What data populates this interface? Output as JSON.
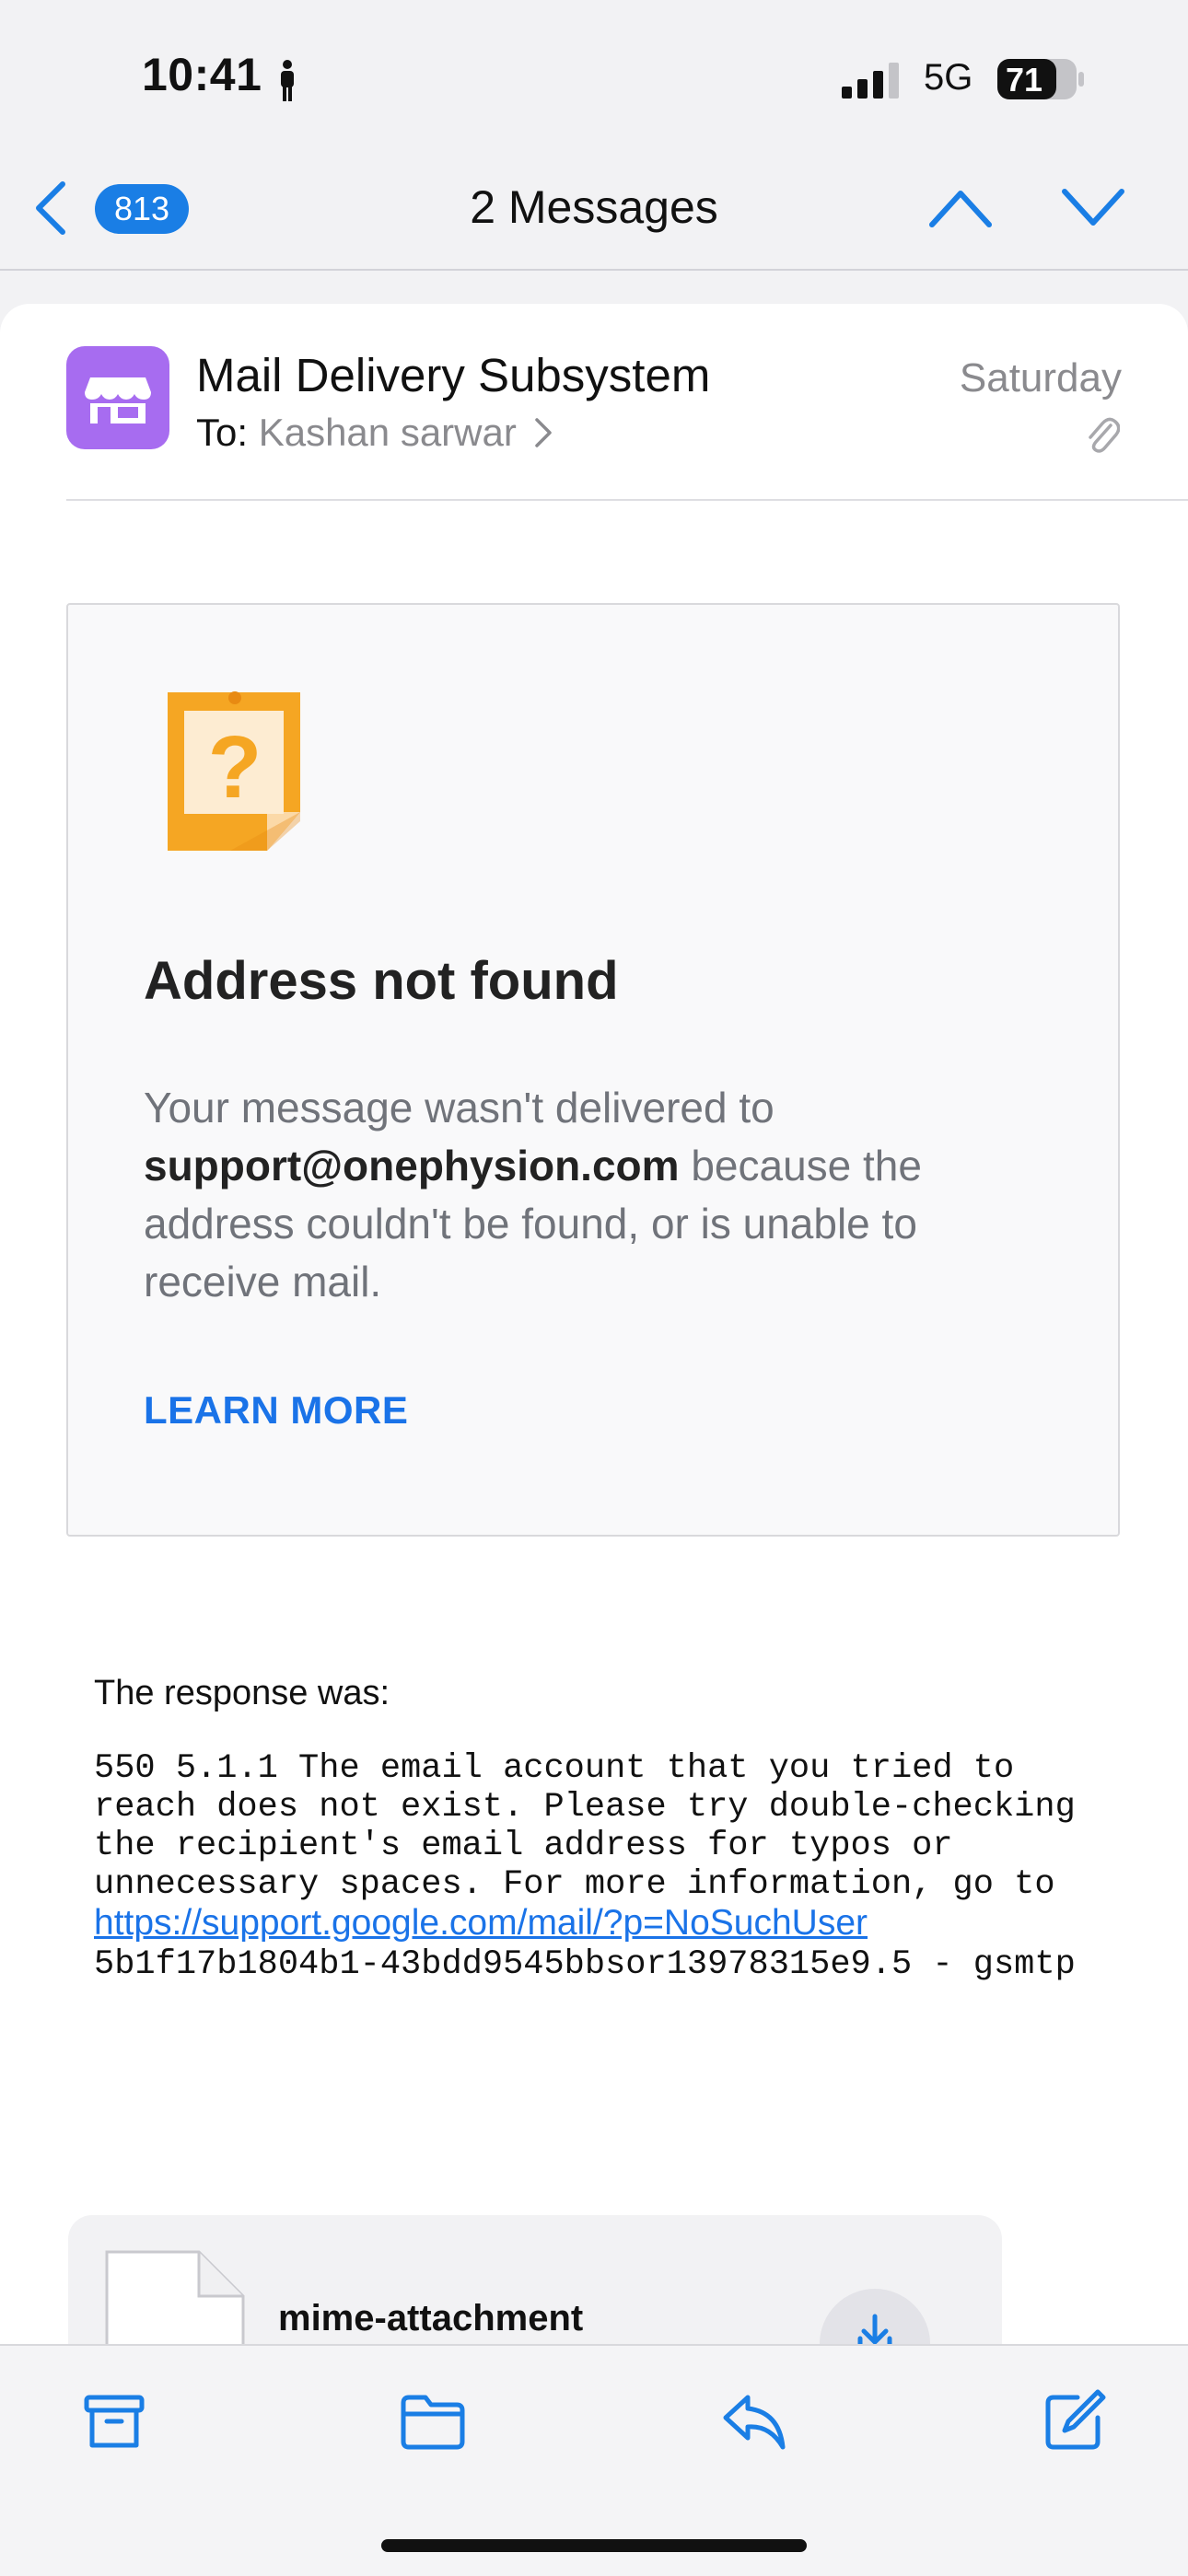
{
  "status_bar": {
    "time": "10:41",
    "network": "5G",
    "battery": "71"
  },
  "nav": {
    "unread_count": "813",
    "title": "2 Messages"
  },
  "message": {
    "sender": "Mail Delivery Subsystem",
    "to_label": "To:",
    "recipient": "Kashan sarwar",
    "date": "Saturday"
  },
  "bounce": {
    "title": "Address not found",
    "text_before": "Your message wasn't delivered to ",
    "email": "support@onephysion.com",
    "text_after": " because the address couldn't be found, or is unable to receive mail.",
    "learn_more": "LEARN MORE"
  },
  "response": {
    "label": "The response was:",
    "body_part1": "550 5.1.1 The email account that you tried to reach does not exist. Please try double-checking the recipient's email address for typos or unnecessary spaces. For more information, go to ",
    "link": "https://support.google.com/mail/?p=NoSuchUser",
    "body_part2": "\n5b1f17b1804b1-43bdd9545bbsor13978315e9.5 - gsmtp"
  },
  "attachment": {
    "name": "mime-attachment"
  },
  "toolbar": {
    "icons": [
      "archive-icon",
      "folder-icon",
      "reply-icon",
      "compose-icon"
    ]
  },
  "colors": {
    "accent": "#1a7ee5",
    "avatar": "#a76cf0",
    "link": "#1a73e8",
    "note_icon": "#f5a623"
  }
}
